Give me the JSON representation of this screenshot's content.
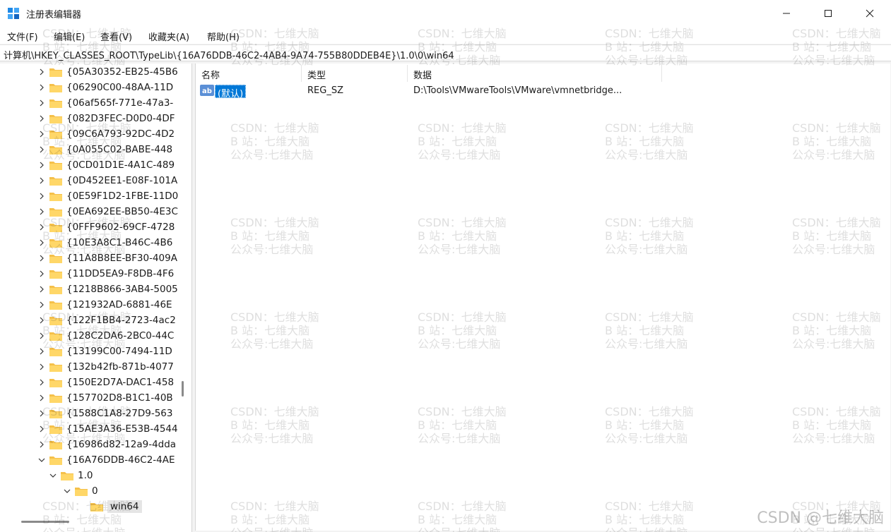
{
  "window": {
    "title": "注册表编辑器",
    "icon": "regedit-icon"
  },
  "menu": [
    "文件(F)",
    "编辑(E)",
    "查看(V)",
    "收藏夹(A)",
    "帮助(H)"
  ],
  "address": "计算机\\HKEY_CLASSES_ROOT\\TypeLib\\{16A76DDB-46C2-4AB4-9A74-755B80DDEB4E}\\1.0\\0\\win64",
  "tree": {
    "items": [
      "{05A30352-EB25-45B6",
      "{06290C00-48AA-11D",
      "{06af565f-771e-47a3-",
      "{082D3FEC-D0D0-4DF",
      "{09C6A793-92DC-4D2",
      "{0A055C02-BABE-448",
      "{0CD01D1E-4A1C-489",
      "{0D452EE1-E08F-101A",
      "{0E59F1D2-1FBE-11D0",
      "{0EA692EE-BB50-4E3C",
      "{0FFF9602-69CF-4728",
      "{10E3A8C1-B46C-4B6",
      "{11A8B8EE-BF30-409A",
      "{11DD5EA9-F8DB-4F6",
      "{1218B866-3AB4-5005",
      "{121932AD-6881-46E",
      "{122F1BB4-2723-4ac2",
      "{128C2DA6-2BC0-44C",
      "{13199C00-7494-11D",
      "{132b42fb-871b-4077",
      "{150E2D7A-DAC1-458",
      "{157702D8-B1C1-40B",
      "{1588C1A8-27D9-563",
      "{15AE3A36-E53B-4544",
      "{16986d82-12a9-4dda",
      "{16A76DDB-46C2-4AE"
    ],
    "child_1": "1.0",
    "child_2": "0",
    "child_3": "win64"
  },
  "list": {
    "headers": [
      "名称",
      "类型",
      "数据"
    ],
    "rows": [
      {
        "name": "(默认)",
        "type": "REG_SZ",
        "data": "D:\\Tools\\VMwareTools\\VMware\\vmnetbridge..."
      }
    ]
  },
  "watermark": {
    "line1": "CSDN：七维大脑",
    "line2": "B 站：七维大脑",
    "line3": "公众号:七维大脑",
    "corner": "CSDN @七维大脑"
  },
  "colors": {
    "selection": "#0078d7",
    "folder": "#f5c04a"
  }
}
